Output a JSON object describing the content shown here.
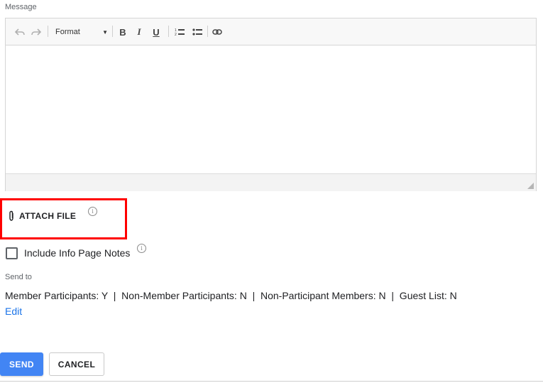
{
  "message": {
    "label": "Message",
    "toolbar": {
      "undo_icon": "undo-icon",
      "redo_icon": "redo-icon",
      "format_label": "Format",
      "bold_label": "B",
      "italic_label": "I",
      "underline_label": "U",
      "numbered_list_icon": "numbered-list-icon",
      "bulleted_list_icon": "bulleted-list-icon",
      "link_icon": "link-icon"
    },
    "body": ""
  },
  "attach": {
    "label": "ATTACH FILE",
    "icon": "paperclip-icon",
    "info_icon": "i",
    "highlight_color": "#ff0000"
  },
  "include_notes": {
    "label": "Include Info Page Notes",
    "checked": false,
    "info_icon": "i"
  },
  "send_to": {
    "label": "Send to",
    "value": "Member Participants: Y  |  Non-Member Participants: N  |  Non-Participant Members: N  |  Guest List: N",
    "edit_label": "Edit"
  },
  "actions": {
    "send_label": "SEND",
    "cancel_label": "CANCEL",
    "send_color": "#4285f4"
  }
}
